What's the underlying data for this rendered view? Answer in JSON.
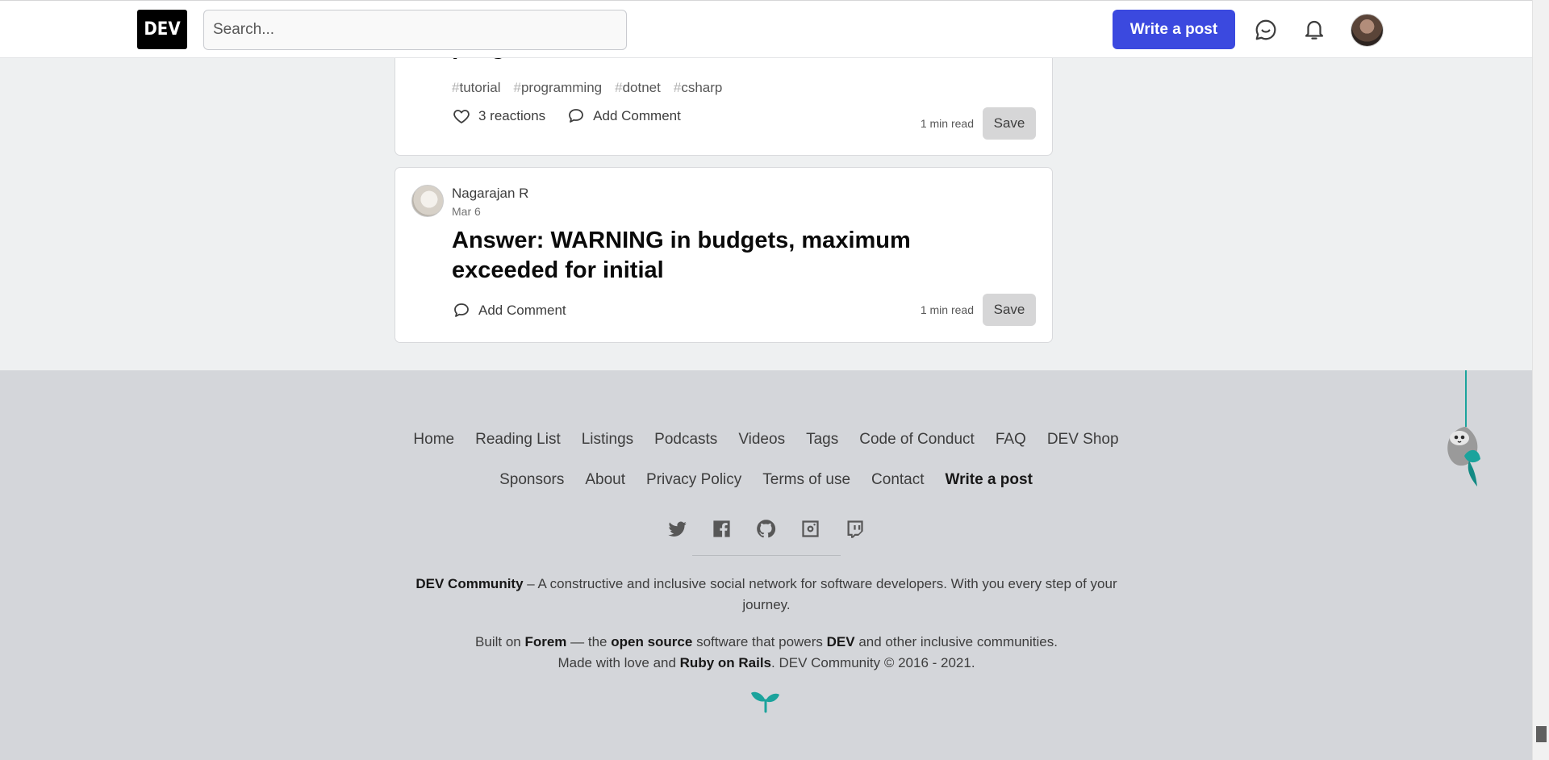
{
  "header": {
    "logo_text": "DEV",
    "search_placeholder": "Search...",
    "write_post_label": "Write a post"
  },
  "colors": {
    "brand_primary": "#3b49df",
    "footer_bg": "#d4d6da",
    "page_bg": "#eef0f1"
  },
  "icons": {
    "messages": "chat-bubble-icon",
    "notifications": "bell-icon",
    "reactions": "heart-icon",
    "comments": "comment-icon"
  },
  "posts": [
    {
      "title_partial": "program",
      "tags": [
        {
          "hash": "#",
          "name": "tutorial"
        },
        {
          "hash": "#",
          "name": "programming"
        },
        {
          "hash": "#",
          "name": "dotnet"
        },
        {
          "hash": "#",
          "name": "csharp"
        }
      ],
      "reactions_label": "3 reactions",
      "comment_label": "Add Comment",
      "read_time": "1 min read",
      "save_label": "Save"
    },
    {
      "author": "Nagarajan R",
      "date": "Mar 6",
      "title": "Answer: WARNING in budgets, maximum exceeded for initial",
      "comment_label": "Add Comment",
      "read_time": "1 min read",
      "save_label": "Save"
    }
  ],
  "footer": {
    "links_row1": [
      "Home",
      "Reading List",
      "Listings",
      "Podcasts",
      "Videos",
      "Tags",
      "Code of Conduct",
      "FAQ",
      "DEV Shop"
    ],
    "links_row2": [
      "Sponsors",
      "About",
      "Privacy Policy",
      "Terms of use",
      "Contact"
    ],
    "write_post_label": "Write a post",
    "social_icons": [
      "twitter-icon",
      "facebook-icon",
      "github-icon",
      "instagram-icon",
      "twitch-icon"
    ],
    "tagline_brand": "DEV Community",
    "tagline_text": " – A constructive and inclusive social network for software developers. With you every step of your journey.",
    "built_prefix": "Built on ",
    "built_forem": "Forem",
    "built_mid1": " — the ",
    "built_open_source": "open source",
    "built_mid2": " software that powers ",
    "built_dev": "DEV",
    "built_suffix": " and other inclusive communities.",
    "made_prefix": "Made with love and ",
    "made_rails": "Ruby on Rails",
    "made_suffix": ". DEV Community © 2016 - 2021."
  }
}
